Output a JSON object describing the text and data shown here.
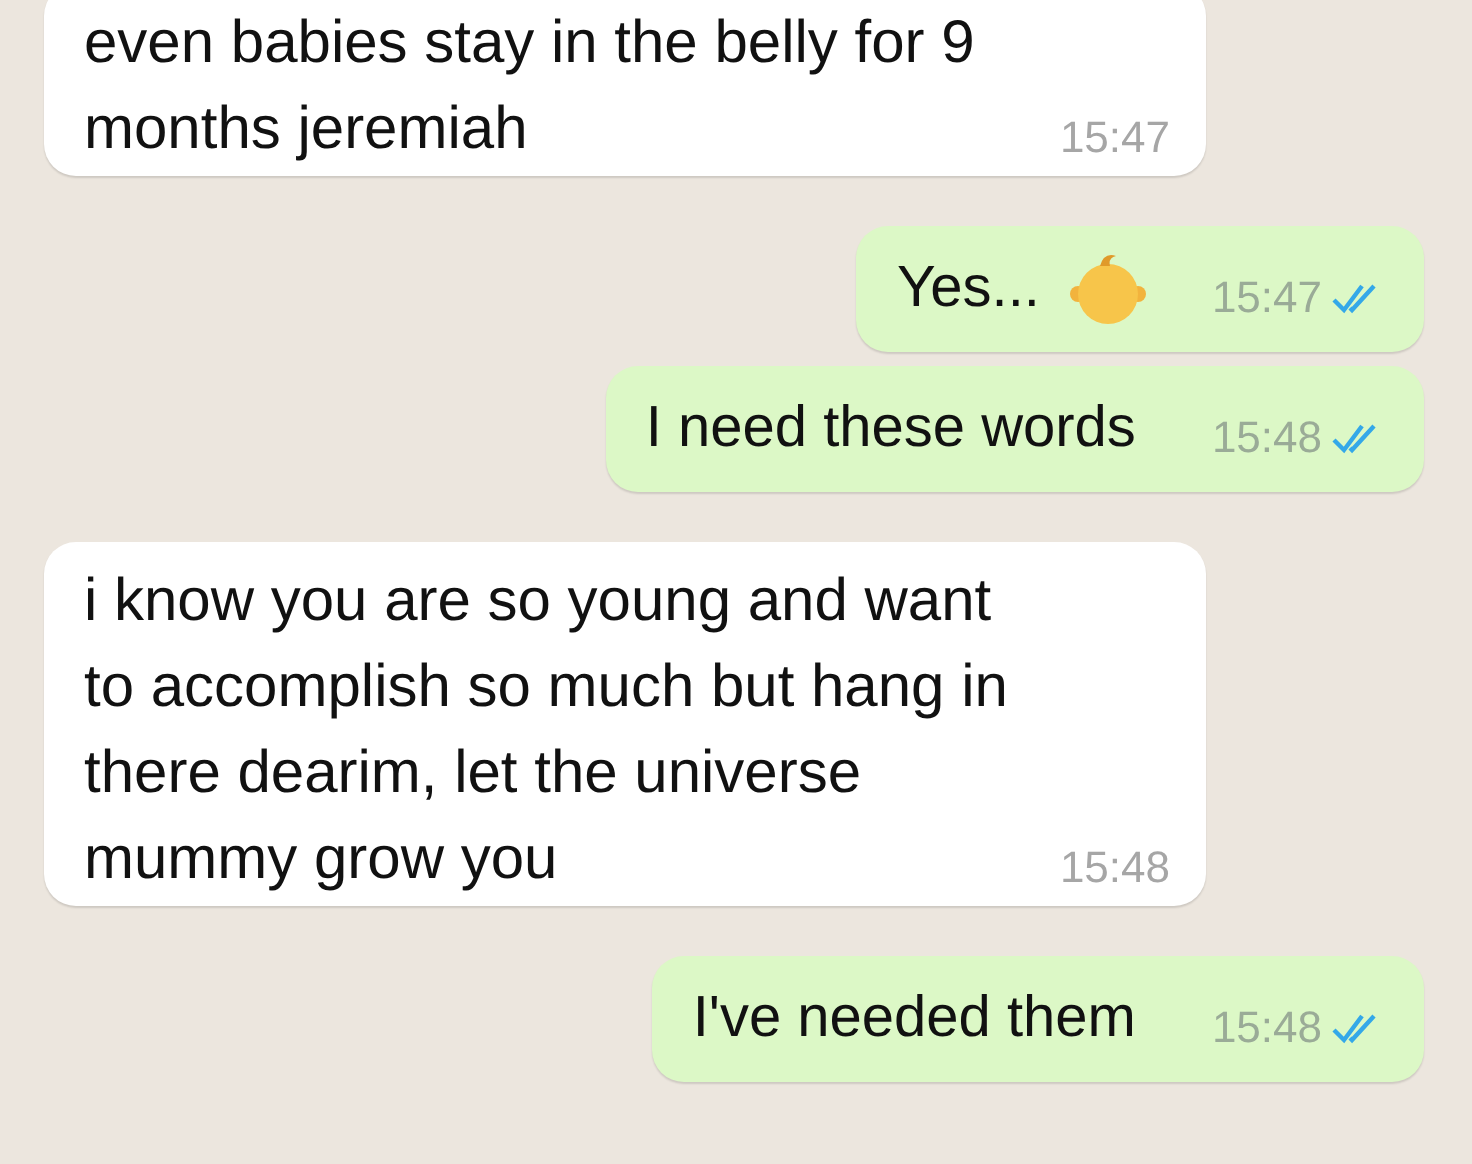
{
  "messages": [
    {
      "kind": "incoming",
      "text": "even babies stay in the belly for 9 months jeremiah",
      "time": "15:47"
    },
    {
      "kind": "outgoing",
      "text": "Yes...",
      "has_emoji": true,
      "time": "15:47",
      "read": true
    },
    {
      "kind": "outgoing",
      "text": "I need these words",
      "has_emoji": false,
      "time": "15:48",
      "read": true
    },
    {
      "kind": "incoming",
      "text": "i know you are so young and want to accomplish so much but hang in there dearim, let the universe mummy grow you",
      "time": "15:48"
    },
    {
      "kind": "outgoing",
      "text": "I've needed them",
      "has_emoji": false,
      "time": "15:48",
      "read": true
    }
  ]
}
